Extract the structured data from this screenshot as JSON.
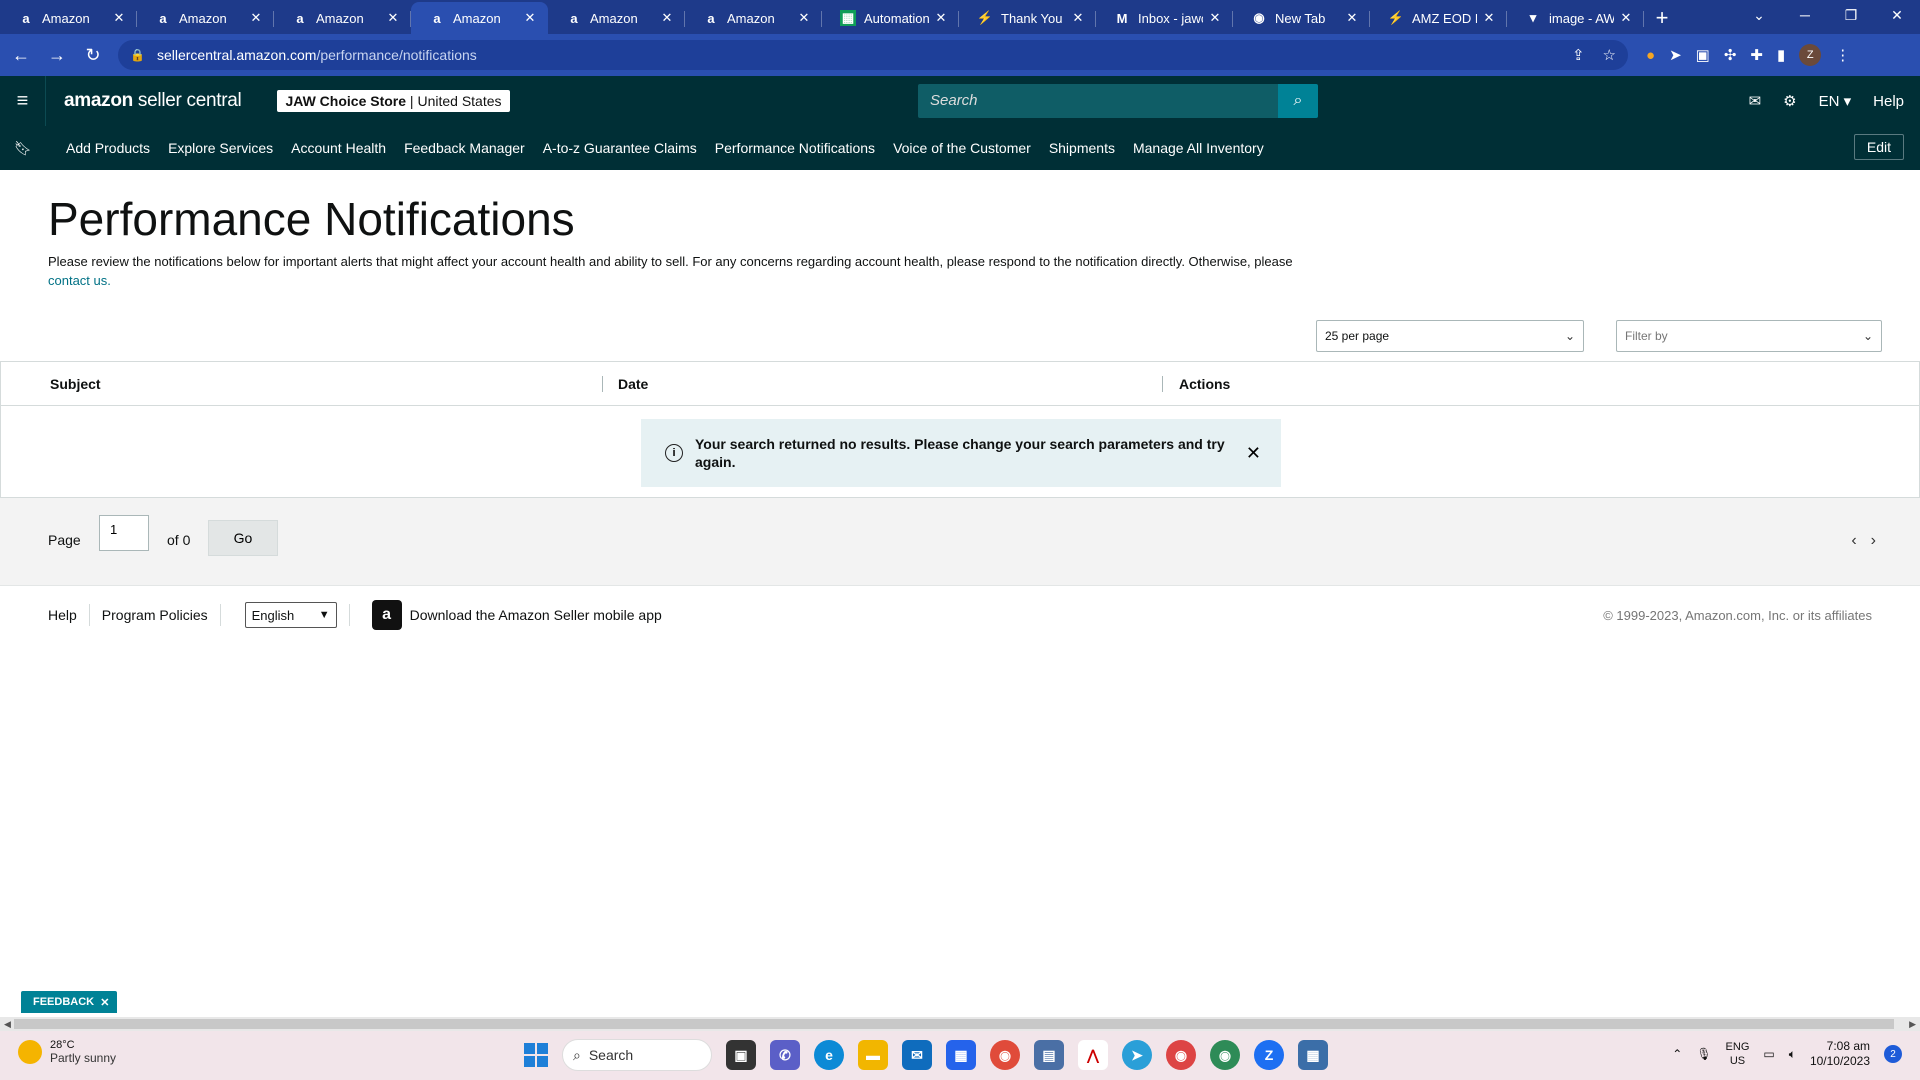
{
  "browser": {
    "tabs": [
      {
        "title": "Amazon",
        "icon": "amazon-icon"
      },
      {
        "title": "Amazon",
        "icon": "amazon-icon"
      },
      {
        "title": "Amazon",
        "icon": "amazon-icon"
      },
      {
        "title": "Amazon",
        "icon": "amazon-icon",
        "active": true
      },
      {
        "title": "Amazon",
        "icon": "amazon-icon"
      },
      {
        "title": "Amazon",
        "icon": "amazon-icon"
      },
      {
        "title": "Automation",
        "icon": "sheets-icon"
      },
      {
        "title": "Thank You",
        "icon": "zapier-icon"
      },
      {
        "title": "Inbox - jawcl",
        "icon": "gmail-icon"
      },
      {
        "title": "New Tab",
        "icon": "chrome-icon"
      },
      {
        "title": "AMZ EOD Re",
        "icon": "zapier-icon"
      },
      {
        "title": "image - AWL",
        "icon": "image-icon"
      }
    ],
    "url_host": "sellercentral.amazon.com",
    "url_path": "/performance/notifications",
    "profile_initial": "Z"
  },
  "header": {
    "logo_bold": "amazon",
    "logo_rest": " seller central",
    "store_name": "JAW Choice Store",
    "store_region": " | United States",
    "search_placeholder": "Search",
    "language": "EN",
    "help": "Help"
  },
  "nav": {
    "links": [
      "Add Products",
      "Explore Services",
      "Account Health",
      "Feedback Manager",
      "A-to-z Guarantee Claims",
      "Performance Notifications",
      "Voice of the Customer",
      "Shipments",
      "Manage All Inventory"
    ],
    "edit": "Edit"
  },
  "main": {
    "title": "Performance Notifications",
    "description": "Please review the notifications below for important alerts that might affect your account health and ability to sell. For any concerns regarding account health, please respond to the notification directly. Otherwise, please ",
    "contact_link": "contact us.",
    "per_page": "25 per page",
    "filter_placeholder": "Filter by",
    "columns": [
      "Subject",
      "Date",
      "Actions"
    ],
    "alert_message": "Your search returned no results. Please change your search parameters and try again."
  },
  "pagination": {
    "page_label": "Page",
    "page_value": "1",
    "of_label": "of 0",
    "go": "Go"
  },
  "footer": {
    "help": "Help",
    "policies": "Program Policies",
    "language": "English",
    "app_link": "Download the Amazon Seller mobile app",
    "copyright": "© 1999-2023, Amazon.com, Inc. or its affiliates"
  },
  "feedback_tab": "FEEDBACK",
  "taskbar": {
    "temp": "28°C",
    "weather": "Partly sunny",
    "search": "Search",
    "lang_top": "ENG",
    "lang_bottom": "US",
    "time": "7:08 am",
    "date": "10/10/2023",
    "notif_count": "2"
  }
}
